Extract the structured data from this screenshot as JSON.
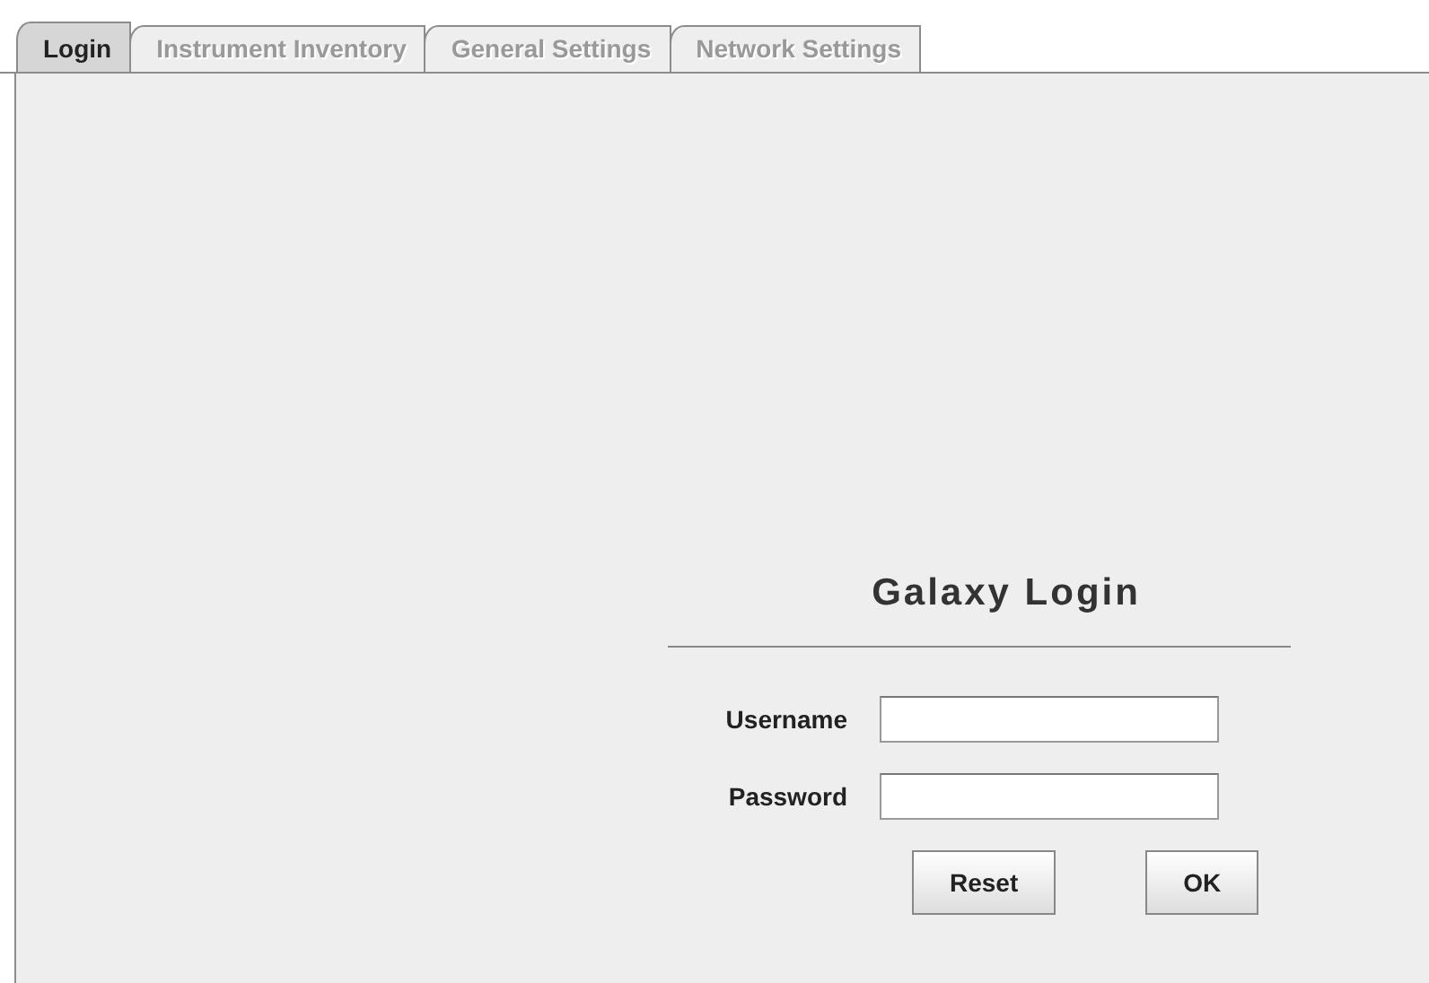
{
  "tabs": [
    {
      "label": "Login",
      "selected": true,
      "disabled": false
    },
    {
      "label": "Instrument Inventory",
      "selected": false,
      "disabled": true
    },
    {
      "label": "General Settings",
      "selected": false,
      "disabled": true
    },
    {
      "label": "Network Settings",
      "selected": false,
      "disabled": true
    }
  ],
  "login": {
    "title": "Galaxy Login",
    "fields": [
      {
        "label": "Username"
      },
      {
        "label": "Password"
      }
    ],
    "buttons": [
      "Reset",
      "OK"
    ]
  }
}
